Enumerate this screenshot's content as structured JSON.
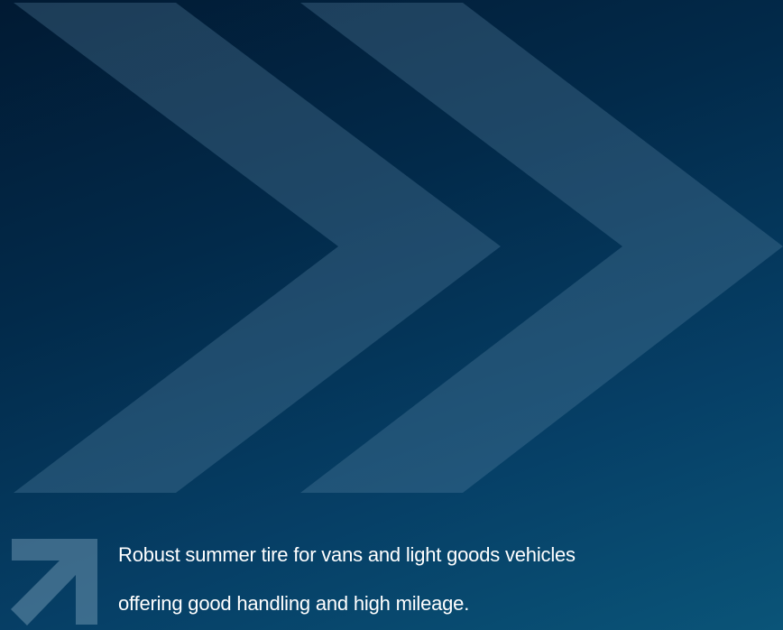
{
  "colors": {
    "background_dark": "#011a33",
    "background_light": "#0a5478",
    "chevron": "#5a87a6",
    "text": "#ffffff"
  },
  "icons": {
    "decorative": "double-chevron-right-icon",
    "bullet": "arrow-up-right-icon"
  },
  "tagline": {
    "line1": "Robust summer tire for vans and light goods vehicles",
    "line2": "offering good handling and high mileage."
  }
}
